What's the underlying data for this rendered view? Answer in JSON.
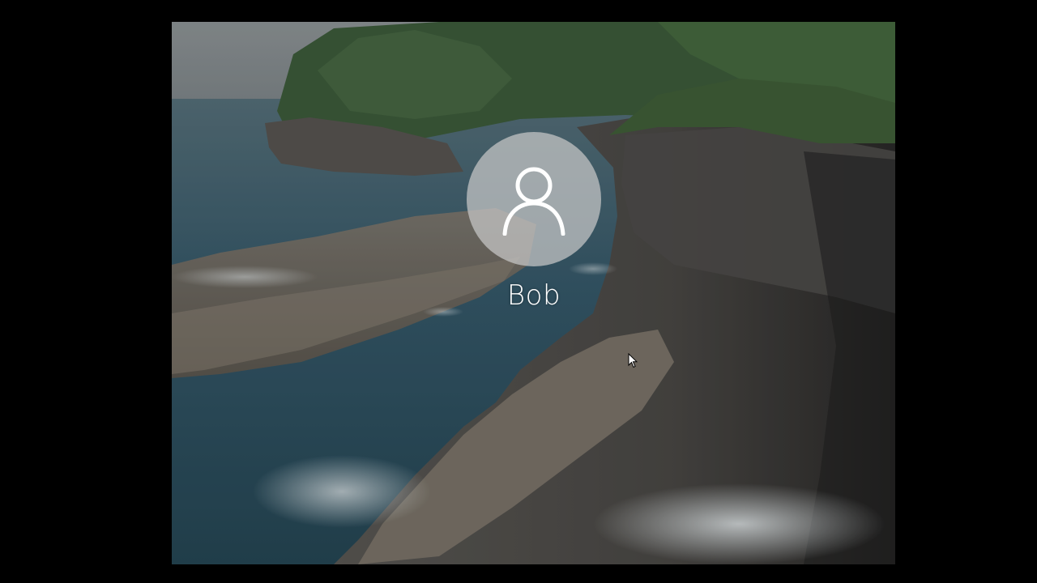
{
  "lock_screen": {
    "user": {
      "name": "Bob",
      "avatar_icon": "user-silhouette-icon"
    },
    "cursor_icon": "mouse-pointer-icon",
    "background": {
      "description_icon": "coastal-cliffs-wallpaper",
      "colors": {
        "sky": "#8e9496",
        "ocean": "#2f5767",
        "forest": "#3b5a3a",
        "rock": "#6c6862",
        "frame": "#000000"
      }
    }
  }
}
